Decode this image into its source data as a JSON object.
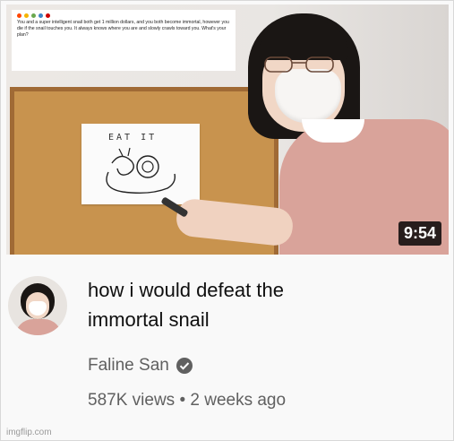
{
  "thumbnail": {
    "duration": "9:54",
    "paper_text": "EAT IT",
    "post_text": "You and a super intelligent snail both get 1 million dollars, and you both become immortal, however you die if the snail touches you. It always knows where you are and slowly crawls toward you. What's your plan?"
  },
  "video": {
    "title_line1": "how i would defeat the",
    "title_line2": "immortal snail",
    "channel": "Faline San",
    "views": "587K views",
    "separator": "•",
    "age": "2 weeks ago"
  },
  "watermark": "imgflip.com",
  "colors": {
    "title": "#0f0f0f",
    "meta": "#606060",
    "verified": "#606060"
  },
  "icons": {
    "verified": "verified-check-icon"
  }
}
